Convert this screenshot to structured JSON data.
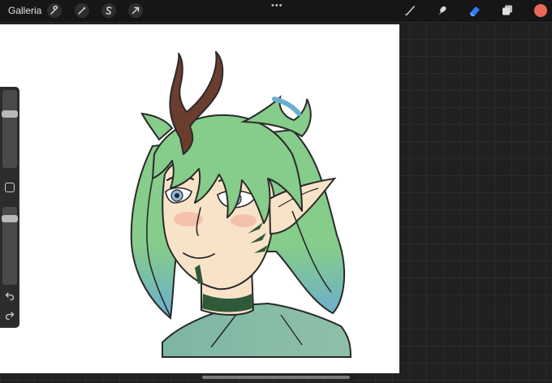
{
  "topbar": {
    "gallery_label": "Galleria",
    "more_glyph": "•••",
    "left_tools": [
      "wrench-icon",
      "magic-wand-icon",
      "selection-s-icon",
      "transform-arrow-icon"
    ],
    "right_tools": [
      "brush-icon",
      "smudge-icon",
      "eraser-icon",
      "layers-icon",
      "color-swatch"
    ],
    "active_tool": "eraser-icon",
    "current_color": "#e8695b",
    "accent": "#2f7bf6"
  },
  "sidebar": {
    "brush_size_level": 0.71,
    "opacity_level": 0.88,
    "controls": [
      "modify-button",
      "undo-icon",
      "redo-icon"
    ]
  },
  "canvas": {
    "background": "#ffffff",
    "artwork": "character-portrait"
  },
  "colors": {
    "hair_green": "#86cc8a",
    "hair_blue": "#6aaed0",
    "antler": "#6b3d2e",
    "skin": "#f9e3c8",
    "blush": "#f1b7a3",
    "outline": "#2a2a2a",
    "marking_dark": "#2f5a3a",
    "collar": "#7eb49a",
    "eye": "#8fb7d6"
  }
}
